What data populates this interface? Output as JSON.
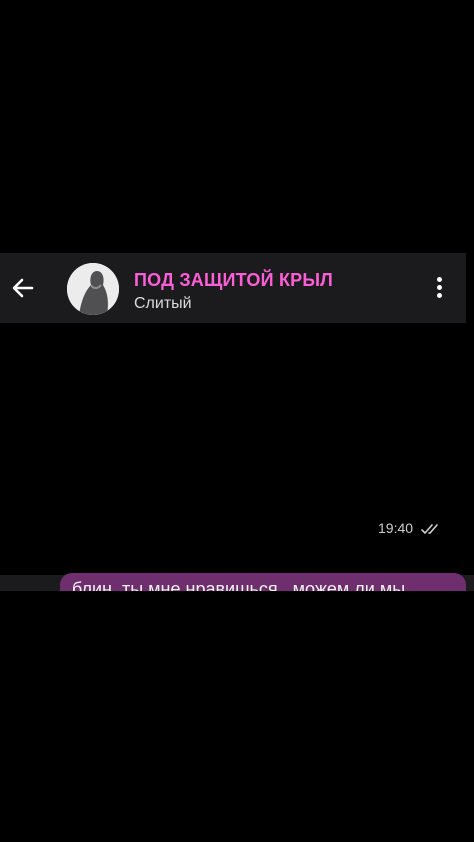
{
  "header": {
    "title": "ПОД ЗАЩИТОЙ КРЫЛ",
    "subtitle": "Слитый",
    "title_color": "#ff5fd6"
  },
  "icons": {
    "back": "arrow-left-icon",
    "menu": "more-vertical-icon"
  },
  "message": {
    "time": "19:40",
    "status": "read",
    "partial_text": "блин, ты мне нравишься , можем ли мы"
  },
  "colors": {
    "background": "#000000",
    "header_bg": "#1b1b1e",
    "bubble_bg": "#6f2f6e"
  }
}
